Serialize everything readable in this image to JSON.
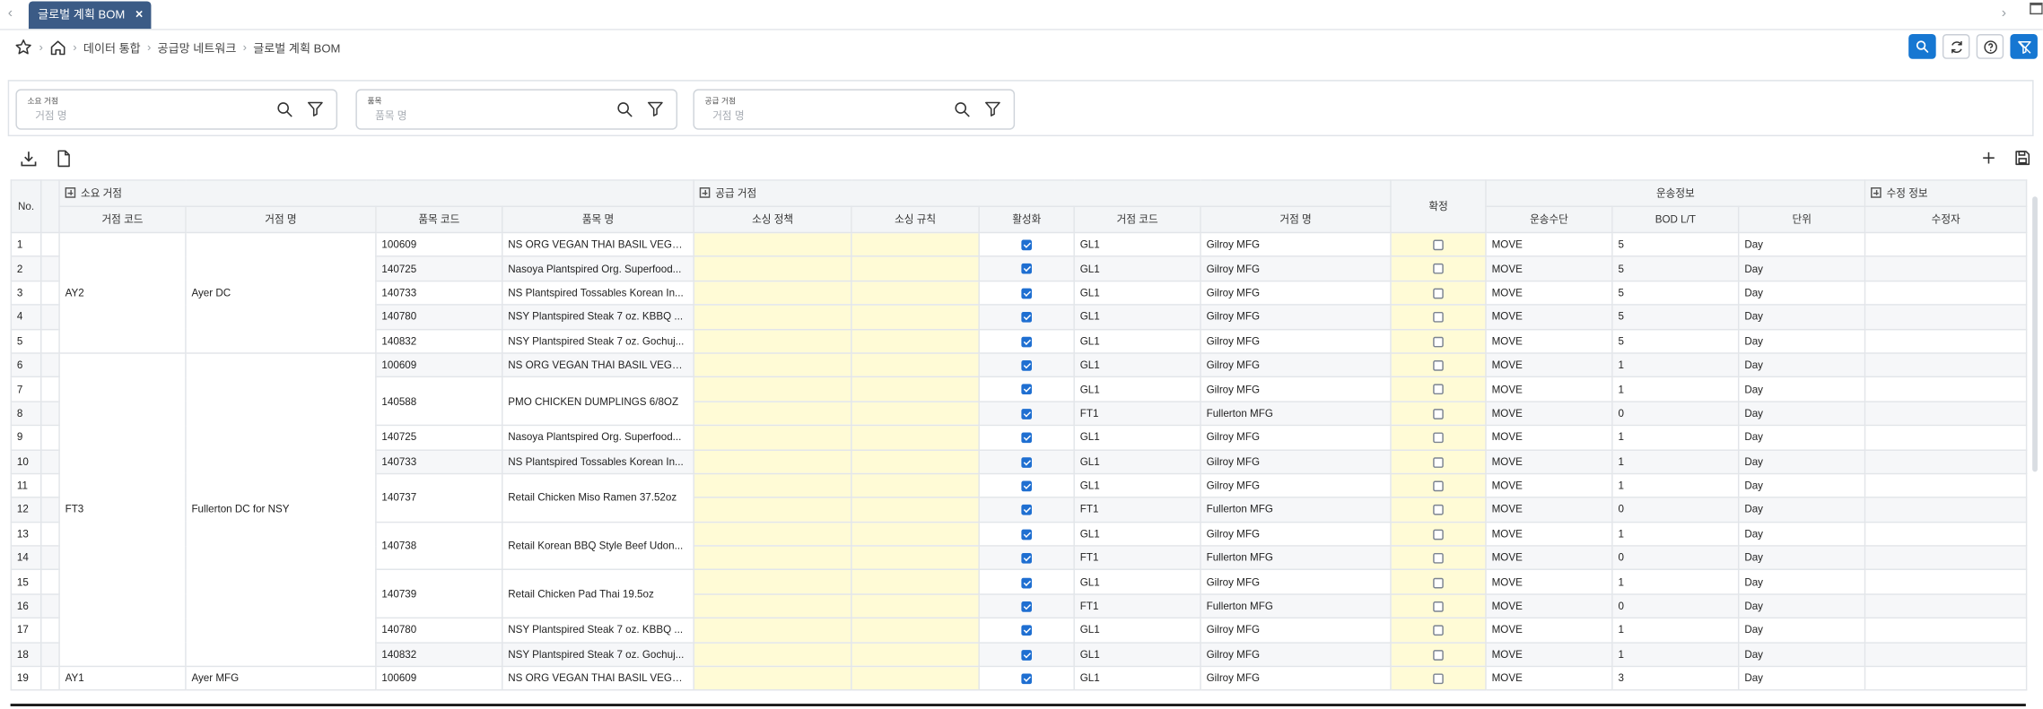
{
  "tabbar": {
    "nav_left": "‹",
    "nav_right": "›",
    "tab_label": "글로벌 계획 BOM",
    "close_glyph": "×"
  },
  "breadcrumb": {
    "items": [
      "데이터 통합",
      "공급망 네트워크",
      "글로벌 계획 BOM"
    ],
    "separator": "›"
  },
  "colors": {
    "accent": "#1677d2",
    "tab": "#3b5b86",
    "editable": "#fffbd6",
    "checkbox": "#1f6fd1"
  },
  "filters": [
    {
      "label": "소요 거점",
      "placeholder": "거점 명"
    },
    {
      "label": "품목",
      "placeholder": "품목 명"
    },
    {
      "label": "공급 거점",
      "placeholder": "거점 명"
    }
  ],
  "grid": {
    "groups": {
      "no": "No.",
      "demand_site": "소요 거점",
      "supply_site": "공급 거점",
      "confirm": "확정",
      "transport": "운송정보",
      "modify": "수정 정보"
    },
    "columns": {
      "site_code": "거점 코드",
      "site_name": "거점 명",
      "item_code": "품목 코드",
      "item_name": "품목 명",
      "sourcing_policy": "소싱 정책",
      "sourcing_rule": "소싱 규칙",
      "active": "활성화",
      "supply_code": "거점 코드",
      "supply_name": "거점 명",
      "mode": "운송수단",
      "bod_lt": "BOD L/T",
      "unit": "단위",
      "modifier": "수정자"
    },
    "rows": [
      {
        "no": "1",
        "site_code": "AY2",
        "site_name": "Ayer DC",
        "item_code": "100609",
        "item_name": "NS ORG VEGAN THAI BASIL VEGET...",
        "active": true,
        "supply_code": "GL1",
        "supply_name": "Gilroy MFG",
        "confirm": false,
        "mode": "MOVE",
        "bod_lt": "5",
        "unit": "Day"
      },
      {
        "no": "2",
        "item_code": "140725",
        "item_name": "Nasoya Plantspired Org. Superfood...",
        "active": true,
        "supply_code": "GL1",
        "supply_name": "Gilroy MFG",
        "confirm": false,
        "mode": "MOVE",
        "bod_lt": "5",
        "unit": "Day"
      },
      {
        "no": "3",
        "item_code": "140733",
        "item_name": "NS Plantspired Tossables Korean In...",
        "active": true,
        "supply_code": "GL1",
        "supply_name": "Gilroy MFG",
        "confirm": false,
        "mode": "MOVE",
        "bod_lt": "5",
        "unit": "Day"
      },
      {
        "no": "4",
        "item_code": "140780",
        "item_name": "NSY Plantspired Steak 7 oz. KBBQ ...",
        "active": true,
        "supply_code": "GL1",
        "supply_name": "Gilroy MFG",
        "confirm": false,
        "mode": "MOVE",
        "bod_lt": "5",
        "unit": "Day"
      },
      {
        "no": "5",
        "item_code": "140832",
        "item_name": "NSY Plantspired Steak 7 oz. Gochuj...",
        "active": true,
        "supply_code": "GL1",
        "supply_name": "Gilroy MFG",
        "confirm": false,
        "mode": "MOVE",
        "bod_lt": "5",
        "unit": "Day"
      },
      {
        "no": "6",
        "site_code": "FT3",
        "site_name": "Fullerton DC for NSY",
        "item_code": "100609",
        "item_name": "NS ORG VEGAN THAI BASIL VEGET...",
        "active": true,
        "supply_code": "GL1",
        "supply_name": "Gilroy MFG",
        "confirm": false,
        "mode": "MOVE",
        "bod_lt": "1",
        "unit": "Day"
      },
      {
        "no": "7",
        "item_code": "140588",
        "item_name": "PMO CHICKEN DUMPLINGS 6/8OZ",
        "active": true,
        "supply_code": "GL1",
        "supply_name": "Gilroy MFG",
        "confirm": false,
        "mode": "MOVE",
        "bod_lt": "1",
        "unit": "Day"
      },
      {
        "no": "8",
        "active": true,
        "supply_code": "FT1",
        "supply_name": "Fullerton MFG",
        "confirm": false,
        "mode": "MOVE",
        "bod_lt": "0",
        "unit": "Day"
      },
      {
        "no": "9",
        "item_code": "140725",
        "item_name": "Nasoya Plantspired Org. Superfood...",
        "active": true,
        "supply_code": "GL1",
        "supply_name": "Gilroy MFG",
        "confirm": false,
        "mode": "MOVE",
        "bod_lt": "1",
        "unit": "Day"
      },
      {
        "no": "10",
        "item_code": "140733",
        "item_name": "NS Plantspired Tossables Korean In...",
        "active": true,
        "supply_code": "GL1",
        "supply_name": "Gilroy MFG",
        "confirm": false,
        "mode": "MOVE",
        "bod_lt": "1",
        "unit": "Day"
      },
      {
        "no": "11",
        "item_code": "140737",
        "item_name": "Retail Chicken Miso Ramen 37.52oz",
        "active": true,
        "supply_code": "GL1",
        "supply_name": "Gilroy MFG",
        "confirm": false,
        "mode": "MOVE",
        "bod_lt": "1",
        "unit": "Day"
      },
      {
        "no": "12",
        "active": true,
        "supply_code": "FT1",
        "supply_name": "Fullerton MFG",
        "confirm": false,
        "mode": "MOVE",
        "bod_lt": "0",
        "unit": "Day"
      },
      {
        "no": "13",
        "item_code": "140738",
        "item_name": "Retail Korean BBQ Style Beef Udon...",
        "active": true,
        "supply_code": "GL1",
        "supply_name": "Gilroy MFG",
        "confirm": false,
        "mode": "MOVE",
        "bod_lt": "1",
        "unit": "Day"
      },
      {
        "no": "14",
        "active": true,
        "supply_code": "FT1",
        "supply_name": "Fullerton MFG",
        "confirm": false,
        "mode": "MOVE",
        "bod_lt": "0",
        "unit": "Day"
      },
      {
        "no": "15",
        "item_code": "140739",
        "item_name": "Retail Chicken Pad Thai 19.5oz",
        "active": true,
        "supply_code": "GL1",
        "supply_name": "Gilroy MFG",
        "confirm": false,
        "mode": "MOVE",
        "bod_lt": "1",
        "unit": "Day"
      },
      {
        "no": "16",
        "active": true,
        "supply_code": "FT1",
        "supply_name": "Fullerton MFG",
        "confirm": false,
        "mode": "MOVE",
        "bod_lt": "0",
        "unit": "Day"
      },
      {
        "no": "17",
        "item_code": "140780",
        "item_name": "NSY Plantspired Steak 7 oz. KBBQ ...",
        "active": true,
        "supply_code": "GL1",
        "supply_name": "Gilroy MFG",
        "confirm": false,
        "mode": "MOVE",
        "bod_lt": "1",
        "unit": "Day"
      },
      {
        "no": "18",
        "item_code": "140832",
        "item_name": "NSY Plantspired Steak 7 oz. Gochuj...",
        "active": true,
        "supply_code": "GL1",
        "supply_name": "Gilroy MFG",
        "confirm": false,
        "mode": "MOVE",
        "bod_lt": "1",
        "unit": "Day"
      },
      {
        "no": "19",
        "site_code": "AY1",
        "site_name": "Ayer MFG",
        "item_code": "100609",
        "item_name": "NS ORG VEGAN THAI BASIL VEGET...",
        "active": true,
        "supply_code": "GL1",
        "supply_name": "Gilroy MFG",
        "confirm": false,
        "mode": "MOVE",
        "bod_lt": "3",
        "unit": "Day"
      }
    ]
  }
}
